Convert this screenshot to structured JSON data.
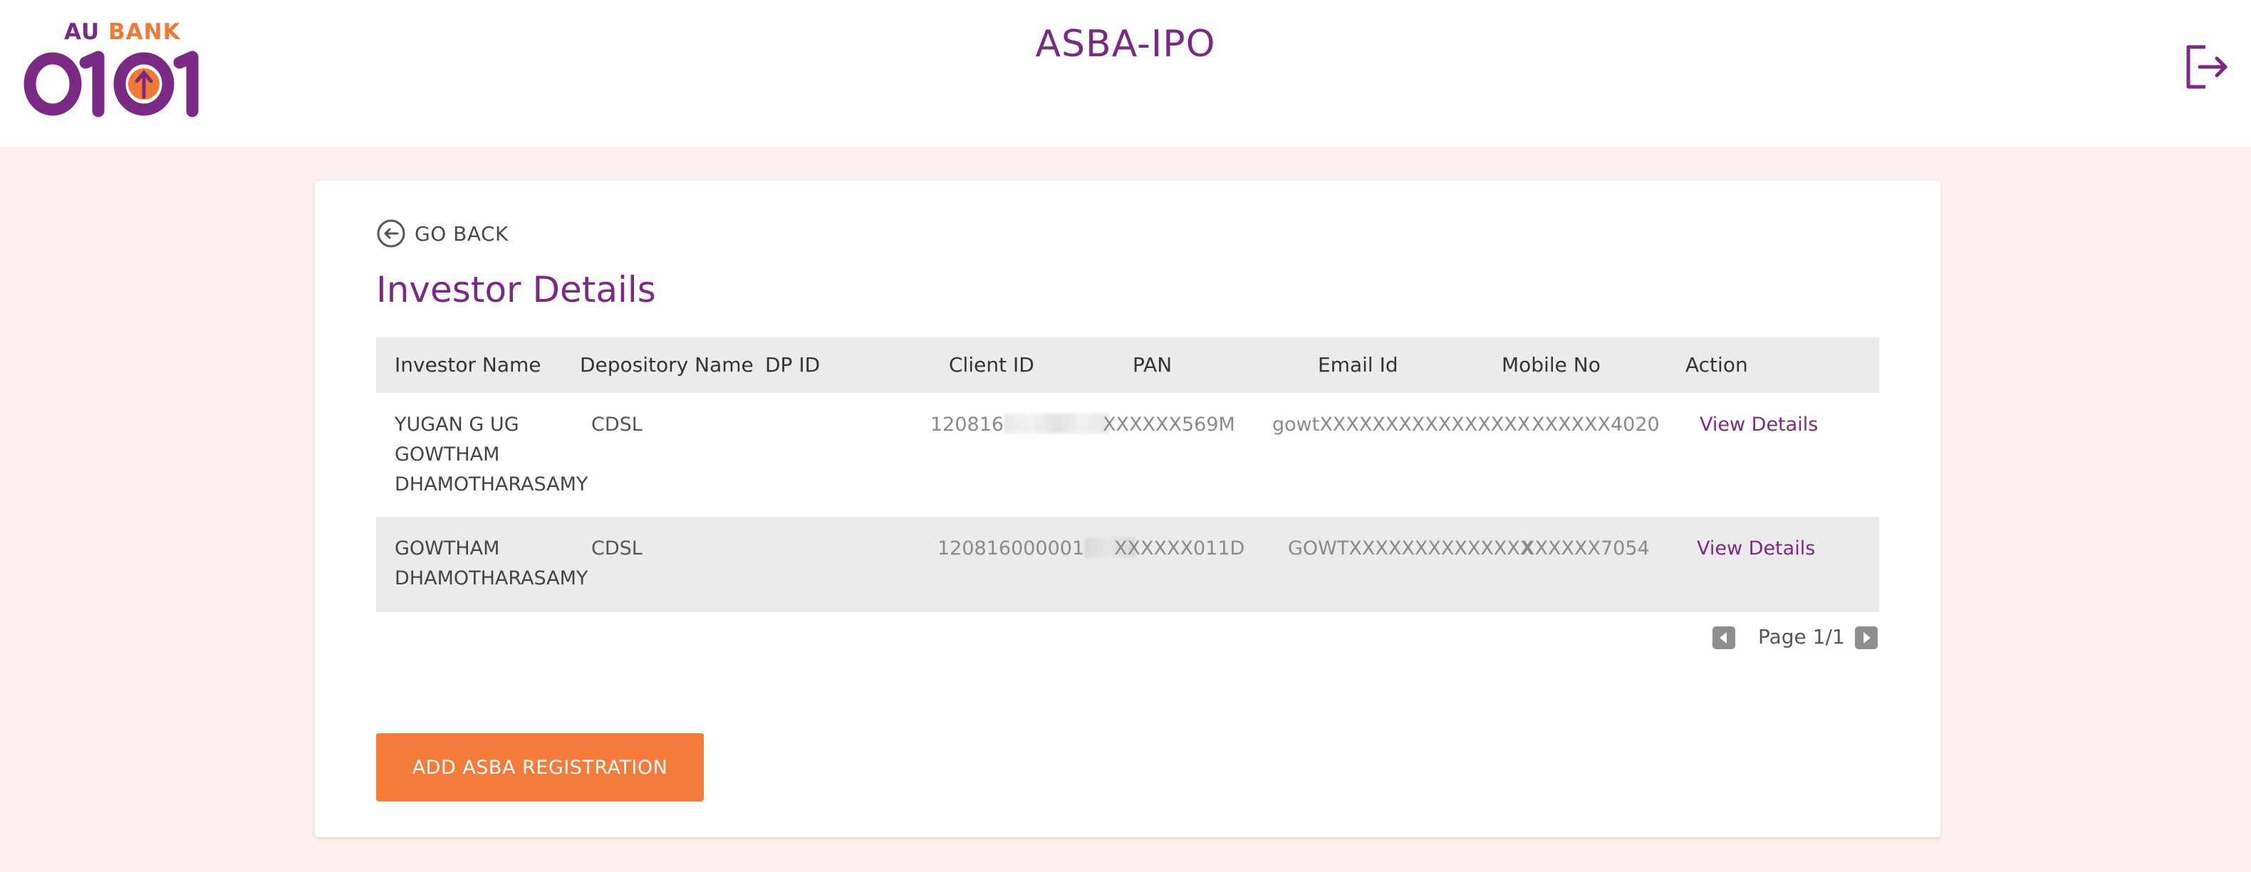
{
  "brand": {
    "logo_line1_a": "AU",
    "logo_line1_b": "BANK",
    "logo_digits": "0101",
    "colors": {
      "purple": "#7a2a85",
      "orange": "#f07a33",
      "page_bg": "#fdf0ee"
    }
  },
  "header": {
    "title": "ASBA-IPO",
    "logout_icon": "logout-icon"
  },
  "main": {
    "go_back_label": "GO BACK",
    "page_title": "Investor Details"
  },
  "table": {
    "headers": [
      "Investor Name",
      "Depository Name",
      "DP ID",
      "Client ID",
      "PAN",
      "Email Id",
      "Mobile No",
      "Action"
    ],
    "rows": [
      {
        "investor_name": "YUGAN G UG GOWTHAM DHAMOTHARASAMY",
        "depository": "CDSL",
        "dp_id": "",
        "client_id": "120816",
        "pan": "XXXXXX569M",
        "email": "gowtXXXXXXXXXXXXXXXX",
        "mobile": "XXXXXX4020",
        "action": "View Details"
      },
      {
        "investor_name": "GOWTHAM DHAMOTHARASAMY",
        "depository": "CDSL",
        "dp_id": "",
        "client_id": "120816000001",
        "pan": "XXXXXX011D",
        "email": "GOWTXXXXXXXXXXXXXX",
        "mobile": "XXXXXX7054",
        "action": "View Details"
      }
    ]
  },
  "pagination": {
    "label": "Page 1/1"
  },
  "actions": {
    "add_registration": "ADD ASBA REGISTRATION"
  }
}
